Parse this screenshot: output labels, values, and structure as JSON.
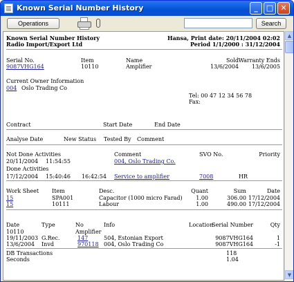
{
  "window": {
    "title": "Known Serial Number History"
  },
  "toolbar": {
    "operations_label": "Operations",
    "search_label": "Search",
    "search_value": ""
  },
  "report": {
    "name": "Known Serial Number History",
    "company": "Radio Import/Export Ltd",
    "print_info": "Hansa, Print date: 20/11/2004 02:02",
    "period": "Period  1/1/2000 : 31/12/2004"
  },
  "serial_header": {
    "serial_no": "Serial No.",
    "item": "Item",
    "name": "Name",
    "sold": "Sold",
    "warranty": "Warranty Ends"
  },
  "serial_row": {
    "serial_no": "9087VHG164",
    "item": "10110",
    "name": "Amplifier",
    "sold": "13/6/2004",
    "warranty": "13/6/2005"
  },
  "owner": {
    "heading": "Current Owner Information",
    "code": "004",
    "name": "Oslo Trading Co",
    "tel": "Tel: 00 47 12 34 56 78",
    "fax": "Fax:"
  },
  "contract_header": {
    "contract": "Contract",
    "start": "Start Date",
    "end": "End Date"
  },
  "analyse_header": {
    "analyse": "Analyse Date",
    "new_status": "New Status",
    "tested_by": "Tested By",
    "comment": "Comment"
  },
  "activities": {
    "not_done_label": "Not Done Activities",
    "comment_label": "Comment",
    "svo_label": "SVO No.",
    "priority_label": "Priority",
    "not_done_row": {
      "date": "20/11/2004",
      "time": "11:54:55",
      "comment": "004, Oslo Trading Co."
    },
    "done_label": "Done Activities",
    "done_row": {
      "date": "17/12/2004",
      "time1": "15:40:46",
      "time2": "16:42:54",
      "comment": "Service to amplifier",
      "svo": "7008",
      "code": "HR"
    }
  },
  "worksheet": {
    "headers": {
      "ws": "Work Sheet",
      "item": "Item",
      "desc": "Desc.",
      "quant": "Quant",
      "sum": "Sum",
      "date": "Date"
    },
    "rows": [
      {
        "ws": "15",
        "item": "SPA001",
        "desc": "Capacitor (1000 micro Farad)",
        "quant": "1.00",
        "sum": "306.00",
        "date": "17/12/2004"
      },
      {
        "ws": "15",
        "item": "10111",
        "desc": "Labour",
        "quant": "1.00",
        "sum": "490.00",
        "date": "17/12/2004"
      }
    ]
  },
  "transactions": {
    "headers": {
      "date": "Date",
      "type": "Type",
      "no": "No",
      "info": "Info",
      "location": "Location",
      "serial": "Serial Number",
      "qty": "Qty"
    },
    "item_line": {
      "item": "10110",
      "name": "Amplifier"
    },
    "rows": [
      {
        "date": "19/11/2003",
        "type": "G.Rec.",
        "no": "147",
        "info": "504, Estonian Export",
        "serial": "9087VHG164",
        "qty": "1"
      },
      {
        "date": "13/6/2004",
        "type": "Invd",
        "no": "970118",
        "info": "004, Oslo Trading Co",
        "serial": "9087VHG164",
        "qty": "-1"
      }
    ],
    "db_label": "DB Transactions",
    "db_value": "118",
    "seconds_label": "Seconds",
    "seconds_value": "1.04"
  }
}
